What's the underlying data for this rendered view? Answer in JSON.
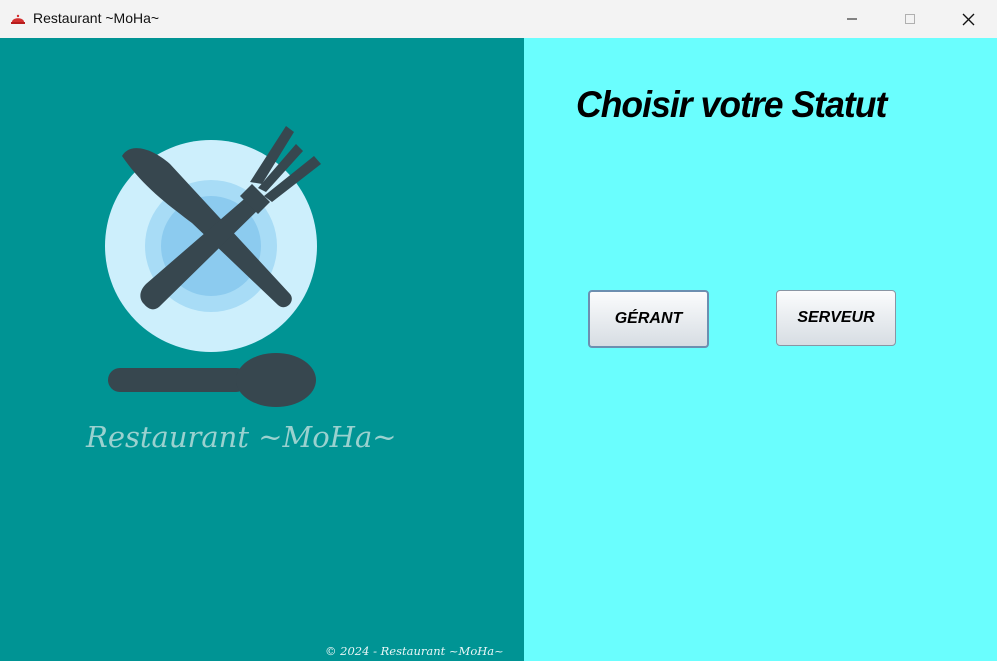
{
  "window": {
    "title": "Restaurant ~MoHa~",
    "icon": "restaurant-app-icon",
    "controls": {
      "minimize_icon": "minimize-icon",
      "maximize_icon": "maximize-icon",
      "close_icon": "close-icon"
    }
  },
  "left_panel": {
    "logo_icon": "plate-cutlery-icon",
    "brand_name": "Restaurant ~MoHa~",
    "copyright": "© 2024 - Restaurant ~MoHa~"
  },
  "right_panel": {
    "heading": "Choisir votre Statut",
    "buttons": {
      "manager_label": "GÉRANT",
      "server_label": "SERVEUR"
    }
  },
  "colors": {
    "left_panel_bg": "#009494",
    "right_panel_bg": "#6afefe",
    "brand_text": "#9ad1cf",
    "titlebar_bg": "#f3f3f3"
  }
}
